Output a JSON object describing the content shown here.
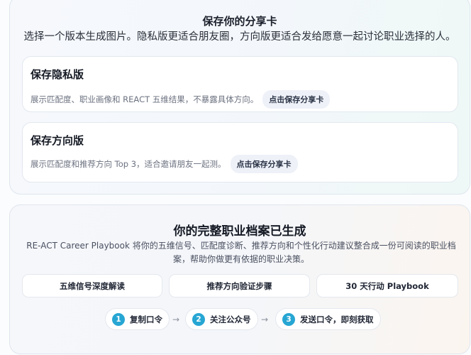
{
  "share": {
    "title": "保存你的分享卡",
    "subtitle": "选择一个版本生成图片。隐私版更适合朋友圈，方向版更适合发给愿意一起讨论职业选择的人。",
    "cards": [
      {
        "title": "保存隐私版",
        "desc": "展示匹配度、职业画像和 REACT 五维结果，不暴露具体方向。",
        "button": "点击保存分享卡"
      },
      {
        "title": "保存方向版",
        "desc": "展示匹配度和推荐方向 Top 3，适合邀请朋友一起测。",
        "button": "点击保存分享卡"
      }
    ]
  },
  "playbook": {
    "title": "你的完整职业档案已生成",
    "desc": "RE-ACT Career Playbook 将你的五维信号、匹配度诊断、推荐方向和个性化行动建议整合成一份可阅读的职业档案，帮助你做更有依据的职业决策。",
    "features": [
      "五维信号深度解读",
      "推荐方向验证步骤",
      "30 天行动 Playbook"
    ],
    "steps": [
      {
        "num": "1",
        "label": "复制口令"
      },
      {
        "num": "2",
        "label": "关注公众号"
      },
      {
        "num": "3",
        "label": "发送口令，即刻获取"
      }
    ],
    "arrow": "→"
  },
  "colors": {
    "step_badge": "#27a6d3",
    "pill_bg": "#eef1f8"
  }
}
